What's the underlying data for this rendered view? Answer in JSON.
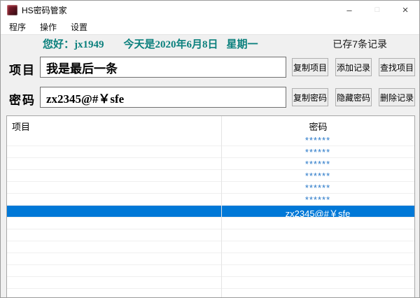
{
  "window": {
    "title": "HS密码管家",
    "controls": {
      "minimize": "–",
      "maximize": "□",
      "close": "×"
    }
  },
  "menu": {
    "items": [
      {
        "label": "程序"
      },
      {
        "label": "操作"
      },
      {
        "label": "设置"
      }
    ]
  },
  "info": {
    "greeting": "您好：jx1949",
    "date": "今天是2020年6月8日",
    "weekday": "星期一",
    "record_count": "已存7条记录"
  },
  "project_row": {
    "label": "项目",
    "value": "我是最后一条",
    "buttons": [
      {
        "label": "复制项目"
      },
      {
        "label": "添加记录"
      },
      {
        "label": "查找项目"
      }
    ]
  },
  "password_row": {
    "label": "密码",
    "value": "zx2345@#￥sfe",
    "buttons": [
      {
        "label": "复制密码"
      },
      {
        "label": "隐藏密码"
      },
      {
        "label": "删除记录"
      }
    ]
  },
  "table": {
    "headers": {
      "project": "项目",
      "password": "密码"
    },
    "rows": [
      {
        "project": "",
        "password": "******",
        "selected": false
      },
      {
        "project": "",
        "password": "******",
        "selected": false
      },
      {
        "project": "",
        "password": "******",
        "selected": false
      },
      {
        "project": "",
        "password": "******",
        "selected": false
      },
      {
        "project": "",
        "password": "******",
        "selected": false
      },
      {
        "project": "",
        "password": "******",
        "selected": false
      },
      {
        "project": "",
        "password": "zx2345@#￥sfe",
        "selected": true
      }
    ]
  },
  "colors": {
    "accent": "#0078d7",
    "masked_text": "#2878c8",
    "greeting_text": "#0b807d"
  }
}
